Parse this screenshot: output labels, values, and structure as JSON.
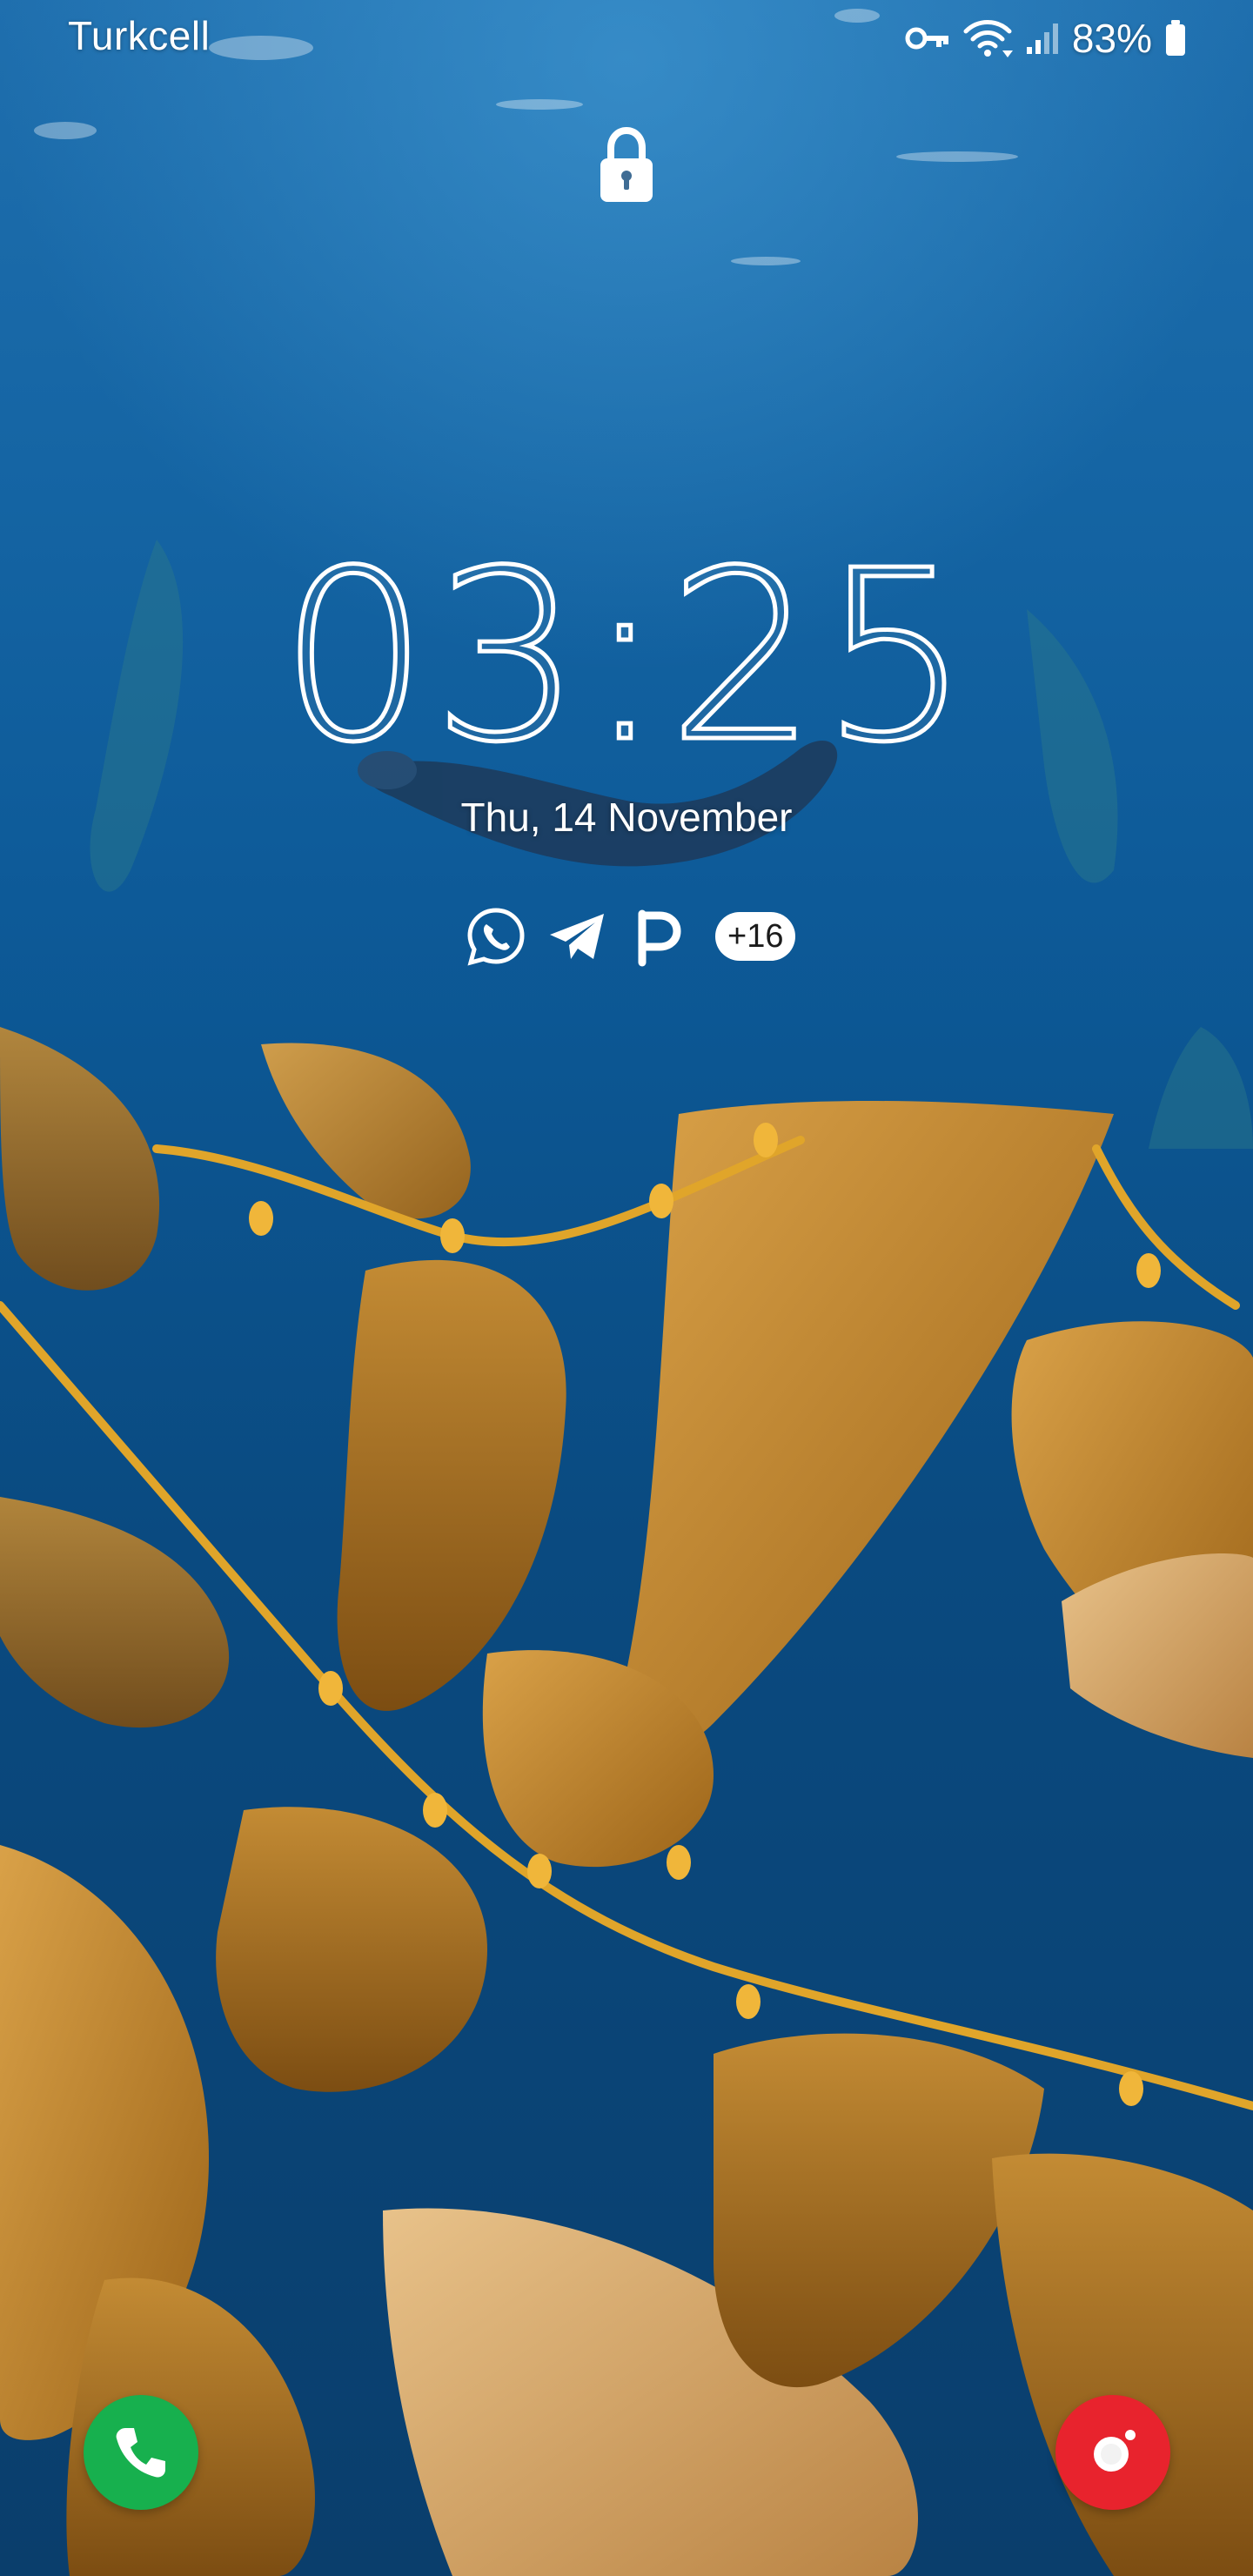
{
  "status_bar": {
    "carrier": "Turkcell",
    "battery_percent": "83%",
    "icons": [
      "vpn-key-icon",
      "wifi-icon",
      "signal-icon",
      "battery-icon"
    ]
  },
  "lock_screen": {
    "lock_icon": "padlock-icon",
    "time": "03:25",
    "date": "Thu, 14 November",
    "notification_icons": [
      "whatsapp-icon",
      "telegram-icon",
      "p-app-icon"
    ],
    "more_notifications": "+16"
  },
  "shortcuts": {
    "left": "phone-icon",
    "right": "camera-icon"
  },
  "colors": {
    "phone": "#17b04e",
    "camera": "#e8232d",
    "water": "#0b4d86",
    "kelp": "#c98a2a"
  }
}
